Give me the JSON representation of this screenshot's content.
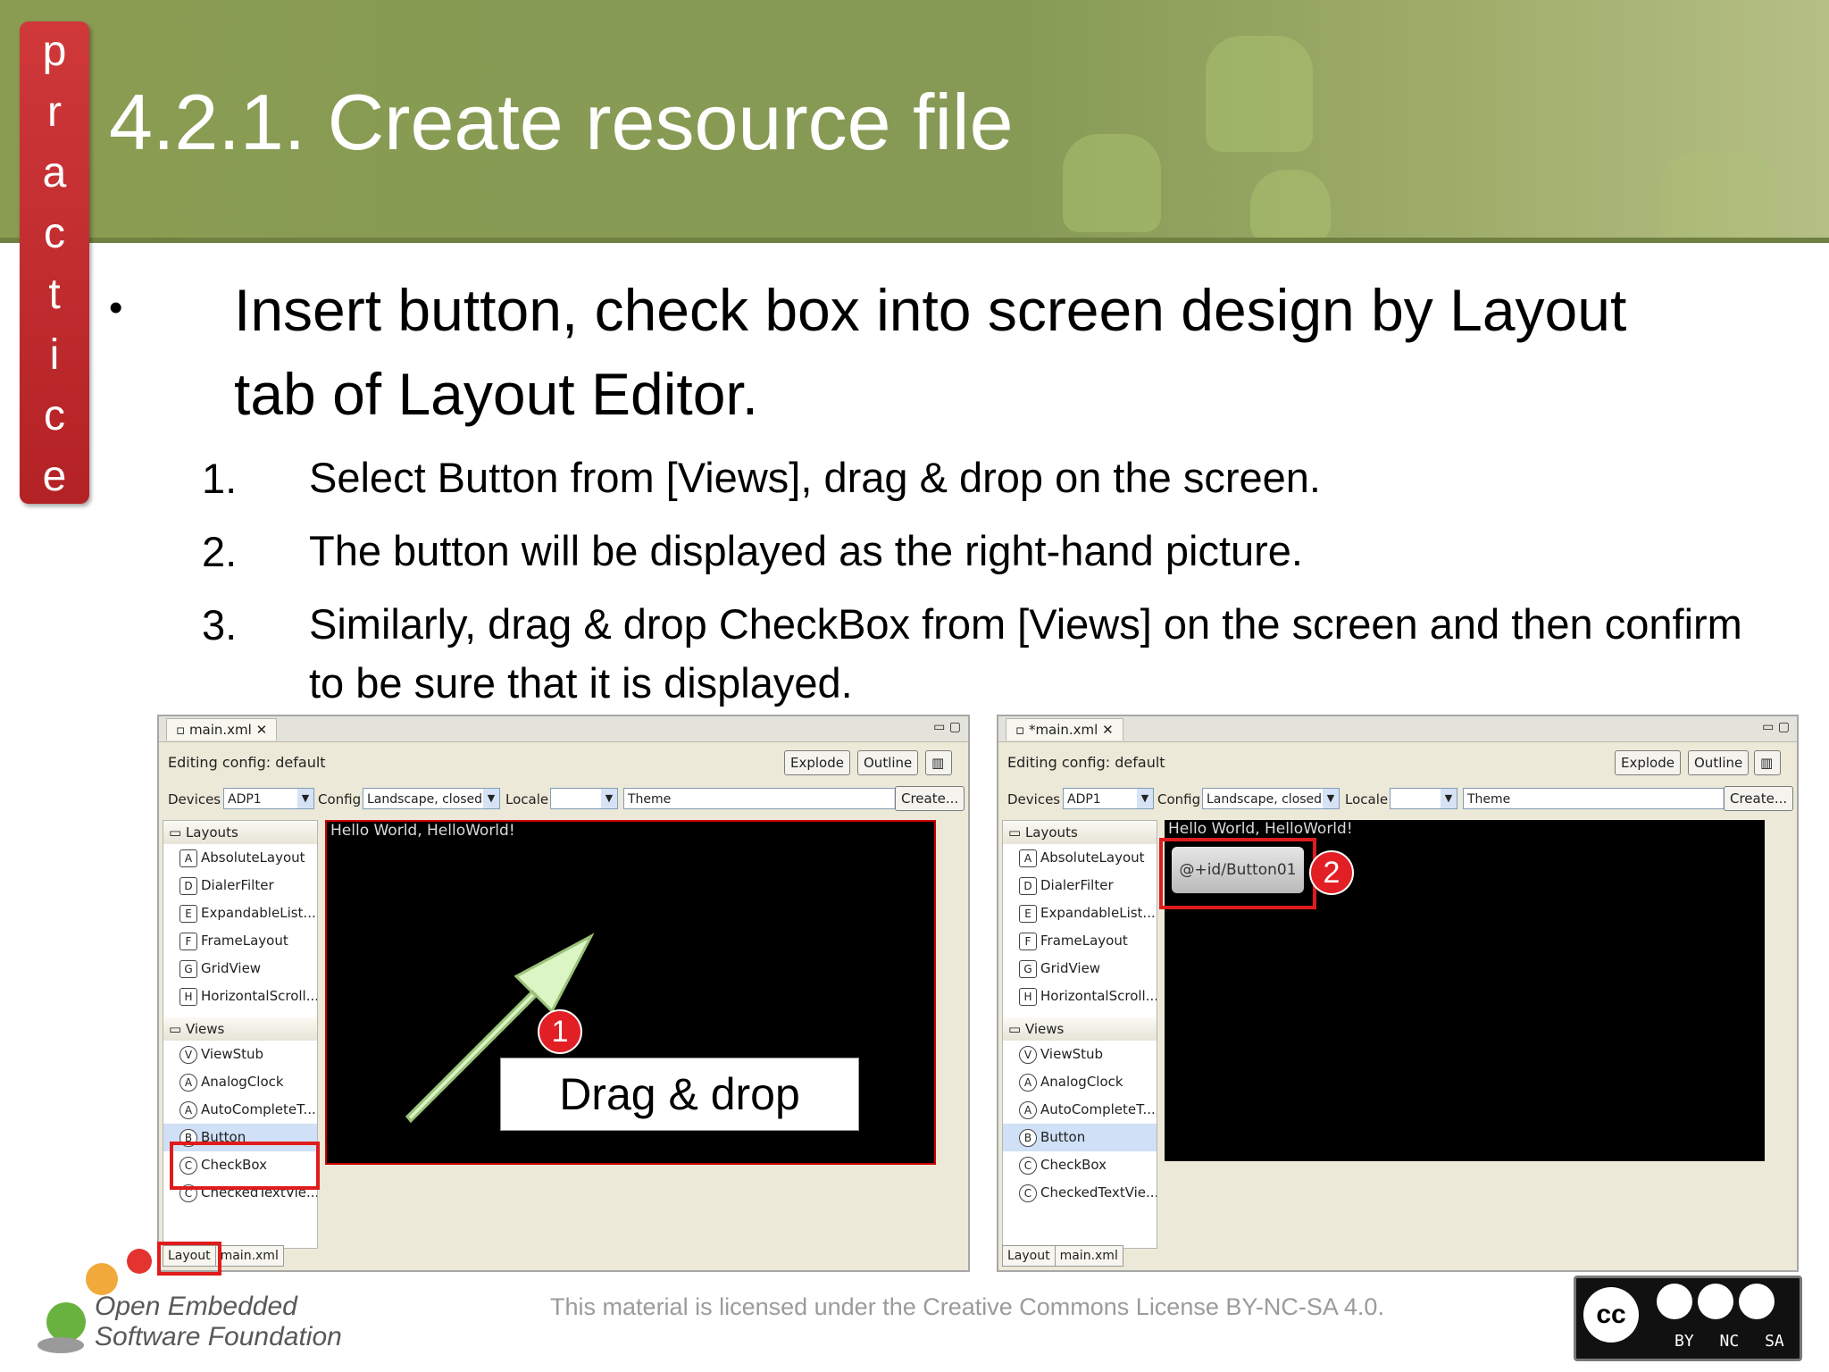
{
  "slide": {
    "side_tab": [
      "p",
      "r",
      "a",
      "c",
      "t",
      "i",
      "c",
      "e"
    ],
    "title": "4.2.1. Create resource file",
    "bullet": "Insert button, check box into screen design by Layout tab of Layout Editor.",
    "steps": [
      {
        "num": "1.",
        "text": "Select Button from [Views], drag & drop on the screen."
      },
      {
        "num": "2.",
        "text": "The button will be displayed as the right-hand picture."
      },
      {
        "num": "3.",
        "text": "Similarly, drag & drop CheckBox from [Views] on the screen and then confirm to be sure that it is displayed."
      }
    ]
  },
  "left_shot": {
    "file_tab": "main.xml",
    "editing_config": "Editing config: default",
    "buttons": {
      "explode": "Explode",
      "outline": "Outline",
      "create": "Create..."
    },
    "devices_label": "Devices",
    "device_value": "ADP1",
    "config_label": "Config",
    "config_value": "Landscape, closed",
    "locale_label": "Locale",
    "theme_value": "Theme",
    "layouts_header": "Layouts",
    "layouts": [
      {
        "icon": "A",
        "label": "AbsoluteLayout"
      },
      {
        "icon": "D",
        "label": "DialerFilter"
      },
      {
        "icon": "E",
        "label": "ExpandableList..."
      },
      {
        "icon": "F",
        "label": "FrameLayout"
      },
      {
        "icon": "G",
        "label": "GridView"
      },
      {
        "icon": "H",
        "label": "HorizontalScroll..."
      }
    ],
    "views_header": "Views",
    "views": [
      {
        "icon": "V",
        "label": "ViewStub"
      },
      {
        "icon": "A",
        "label": "AnalogClock"
      },
      {
        "icon": "A",
        "label": "AutoCompleteT..."
      },
      {
        "icon": "B",
        "label": "Button"
      },
      {
        "icon": "C",
        "label": "CheckBox"
      },
      {
        "icon": "C",
        "label": "CheckedTextVie..."
      }
    ],
    "hello": "Hello World, HelloWorld!",
    "drag_label": "Drag & drop",
    "callout": "1",
    "bottom_tabs": [
      "Layout",
      "main.xml"
    ]
  },
  "right_shot": {
    "file_tab": "*main.xml",
    "editing_config": "Editing config: default",
    "buttons": {
      "explode": "Explode",
      "outline": "Outline",
      "create": "Create..."
    },
    "devices_label": "Devices",
    "device_value": "ADP1",
    "config_label": "Config",
    "config_value": "Landscape, closed",
    "locale_label": "Locale",
    "theme_value": "Theme",
    "layouts_header": "Layouts",
    "layouts": [
      {
        "icon": "A",
        "label": "AbsoluteLayout"
      },
      {
        "icon": "D",
        "label": "DialerFilter"
      },
      {
        "icon": "E",
        "label": "ExpandableList..."
      },
      {
        "icon": "F",
        "label": "FrameLayout"
      },
      {
        "icon": "G",
        "label": "GridView"
      },
      {
        "icon": "H",
        "label": "HorizontalScroll..."
      }
    ],
    "views_header": "Views",
    "views": [
      {
        "icon": "V",
        "label": "ViewStub"
      },
      {
        "icon": "A",
        "label": "AnalogClock"
      },
      {
        "icon": "A",
        "label": "AutoCompleteT..."
      },
      {
        "icon": "B",
        "label": "Button"
      },
      {
        "icon": "C",
        "label": "CheckBox"
      },
      {
        "icon": "C",
        "label": "CheckedTextVie..."
      }
    ],
    "hello": "Hello World, HelloWorld!",
    "dropped_button": "@+id/Button01",
    "callout": "2",
    "bottom_tabs": [
      "Layout",
      "main.xml"
    ]
  },
  "footer": {
    "logo_line1": "Open Embedded",
    "logo_line2": "Software Foundation",
    "copyright": "This material is licensed under the Creative Commons License BY-NC-SA 4.0.",
    "cc_labels": [
      "cc",
      "BY",
      "NC",
      "SA"
    ]
  },
  "colors": {
    "accent_red": "#e01b1b",
    "header_green": "#8a9c52",
    "arrow_green": "#d6f2b8"
  }
}
